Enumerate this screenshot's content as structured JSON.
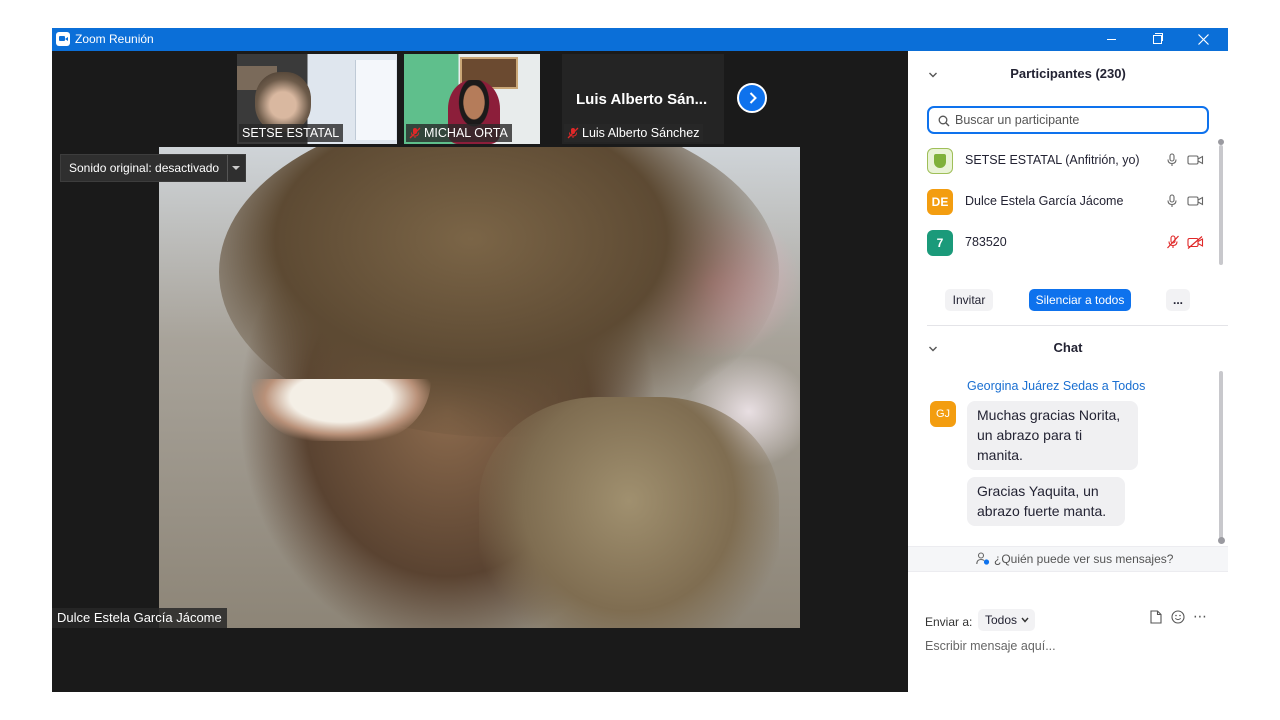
{
  "window": {
    "title": "Zoom Reunión",
    "colors": {
      "titlebar": "#0b6fd8",
      "accent": "#0e72ed",
      "mute_red": "#e02828"
    }
  },
  "thumbnails": [
    {
      "name": "SETSE ESTATAL",
      "muted": false
    },
    {
      "name": "MICHAL ORTA",
      "muted": true
    },
    {
      "name": "Luis Alberto Sánchez",
      "display_name": "Luis Alberto Sán...",
      "muted": true
    }
  ],
  "sound_chip": {
    "label": "Sonido original: desactivado"
  },
  "main_video": {
    "speaker": "Dulce Estela García Jácome"
  },
  "participants": {
    "title": "Participantes (230)",
    "search_placeholder": "Buscar un participante",
    "list": [
      {
        "name": "SETSE ESTATAL (Anfitrión, yo)",
        "avatar": "logo",
        "avatar_color": "#9fbf58",
        "mic": "on",
        "video": "on"
      },
      {
        "name": "Dulce Estela García Jácome",
        "avatar": "DE",
        "avatar_color": "#f39d10",
        "mic": "on",
        "video": "on"
      },
      {
        "name": "783520",
        "avatar": "7",
        "avatar_color": "#1b9a7a",
        "mic": "muted",
        "video": "off"
      }
    ],
    "buttons": {
      "invite": "Invitar",
      "mute_all": "Silenciar a todos",
      "more": "..."
    }
  },
  "chat": {
    "title": "Chat",
    "messages": [
      {
        "sender": "Georgina Juárez Sedas a Todos",
        "avatar": "GJ",
        "avatar_color": "#f39d10",
        "lines": [
          "Muchas gracias Norita, un abrazo para ti manita.",
          "Gracias Yaquita, un abrazo fuerte manta."
        ]
      }
    ],
    "who_can_see": "¿Quién puede ver sus mensajes?",
    "send_to_label": "Enviar a:",
    "send_to_value": "Todos",
    "input_placeholder": "Escribir mensaje aquí..."
  }
}
